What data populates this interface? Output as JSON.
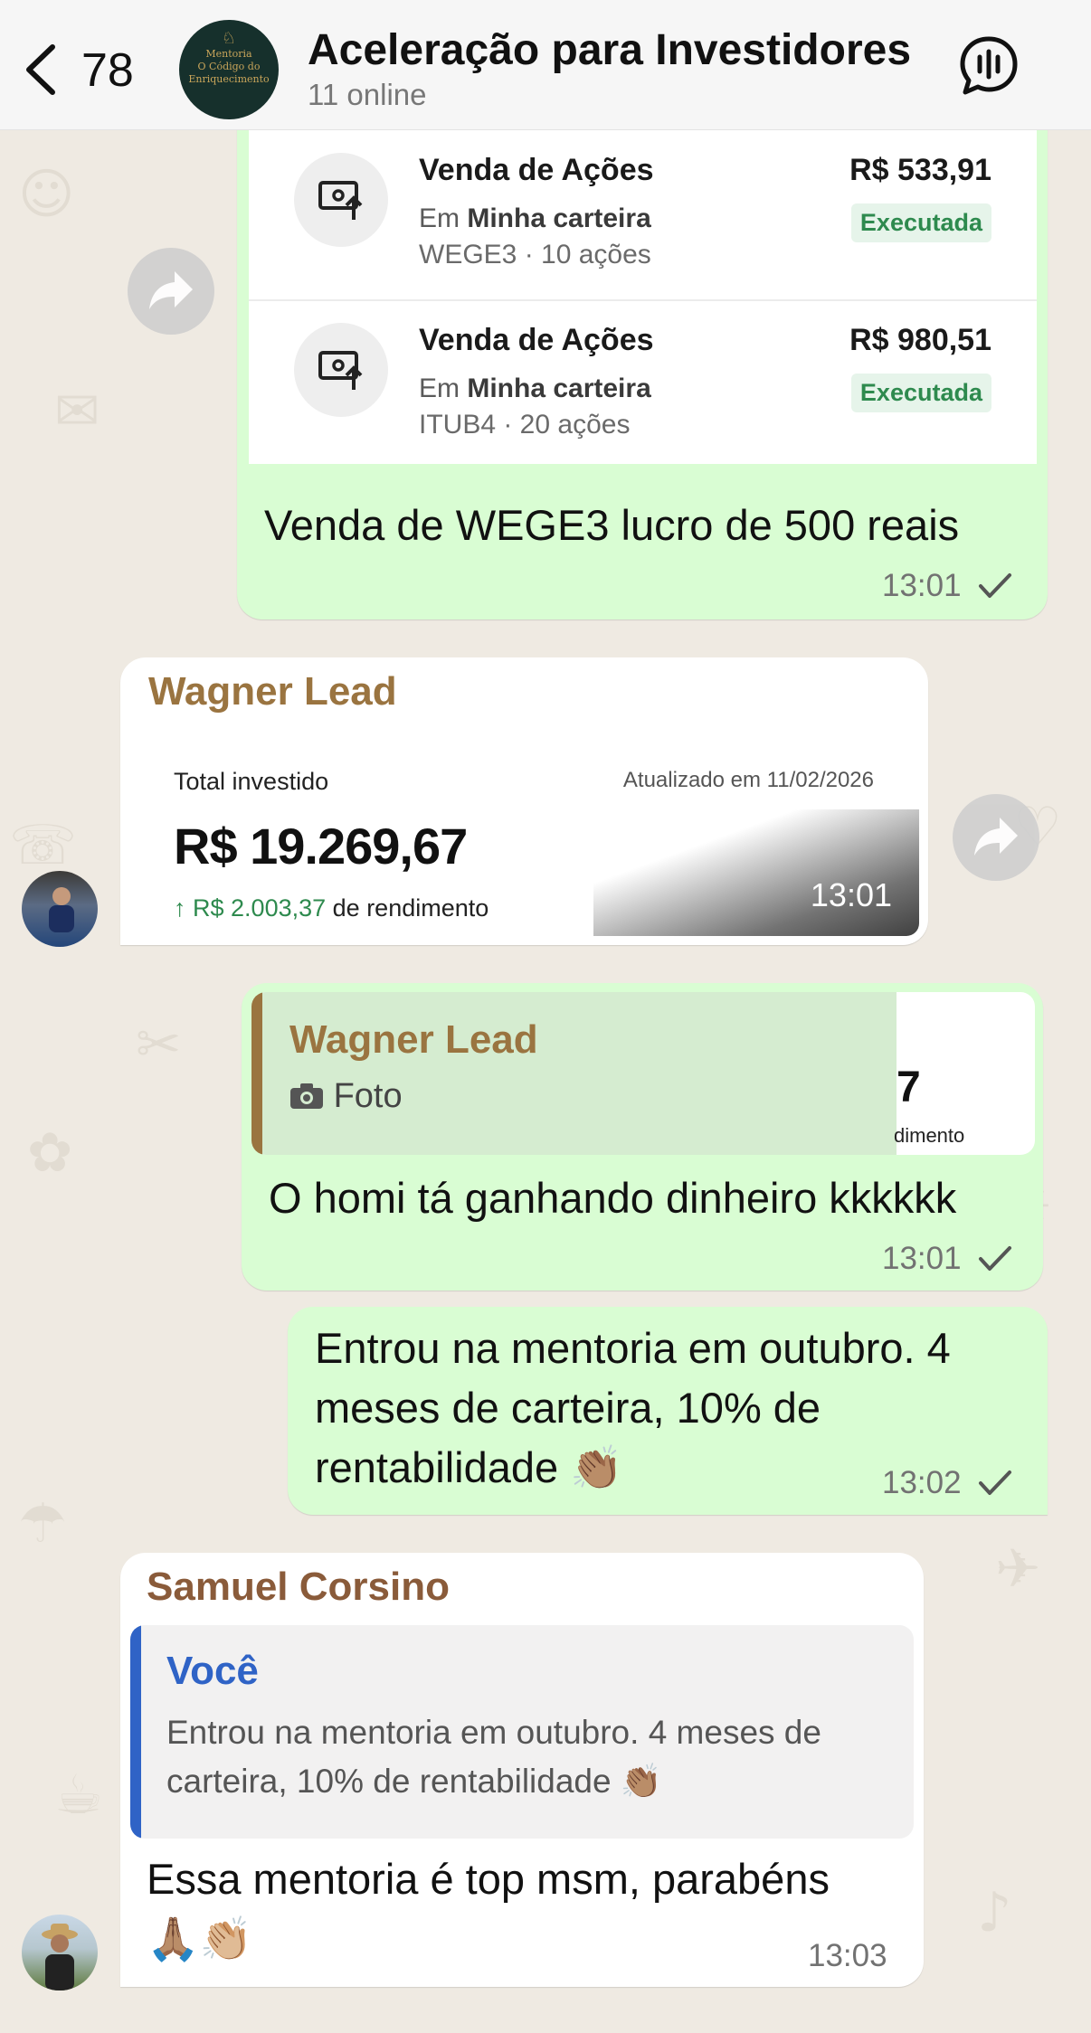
{
  "header": {
    "unread_count": "78",
    "title": "Aceleração para Investidores",
    "subtitle": "11 online",
    "avatar_lines": [
      "Mentoria",
      "O Código do",
      "Enriquecimento"
    ]
  },
  "transactions": [
    {
      "title": "Venda de Ações",
      "where_prefix": "Em",
      "where": "Minha carteira",
      "detail": "WEGE3 · 10 ações",
      "amount": "R$ 533,91",
      "status": "Executada"
    },
    {
      "title": "Venda de Ações",
      "where_prefix": "Em",
      "where": "Minha carteira",
      "detail": "ITUB4 · 20 ações",
      "amount": "R$ 980,51",
      "status": "Executada"
    }
  ],
  "messages": {
    "m1": {
      "text": "Venda de WEGE3 lucro de 500 reais",
      "time": "13:01"
    },
    "m2": {
      "sender": "Wagner Lead",
      "photo": {
        "label": "Total investido",
        "updated": "Atualizado em 11/02/2026",
        "total": "R$ 19.269,67",
        "gain_arrow": "↑",
        "gain_value": "R$ 2.003,37",
        "gain_suffix": "de rendimento"
      },
      "time": "13:01"
    },
    "m3": {
      "quote_sender": "Wagner Lead",
      "quote_type": "Foto",
      "quote_thumb_text": "dimento",
      "text": "O homi tá ganhando dinheiro kkkkkk",
      "time": "13:01"
    },
    "m4": {
      "lines": [
        "Entrou na mentoria em outubro. 4",
        "meses de carteira, 10% de",
        "rentabilidade 👏🏽"
      ],
      "time": "13:02"
    },
    "m5": {
      "sender": "Samuel Corsino",
      "quote_sender": "Você",
      "quote_lines": [
        "Entrou na mentoria em outubro. 4 meses de",
        "carteira, 10% de rentabilidade 👏🏽"
      ],
      "lines": [
        "Essa mentoria é top msm, parabéns",
        "🙏🏽👏🏼"
      ],
      "time": "13:03"
    }
  },
  "colors": {
    "chat_bg": "#efeae2",
    "outgoing_bubble": "#d9fdd3",
    "incoming_bubble": "#ffffff",
    "sender_wagner": "#9a7440",
    "sender_samuel": "#8a5b3a",
    "quote_you": "#2f63c6",
    "gain_green": "#2e8a4e"
  },
  "icons": [
    "back-chevron-icon",
    "voice-chat-icon",
    "sell-stock-icon",
    "forward-icon",
    "camera-icon",
    "read-check-icon"
  ]
}
